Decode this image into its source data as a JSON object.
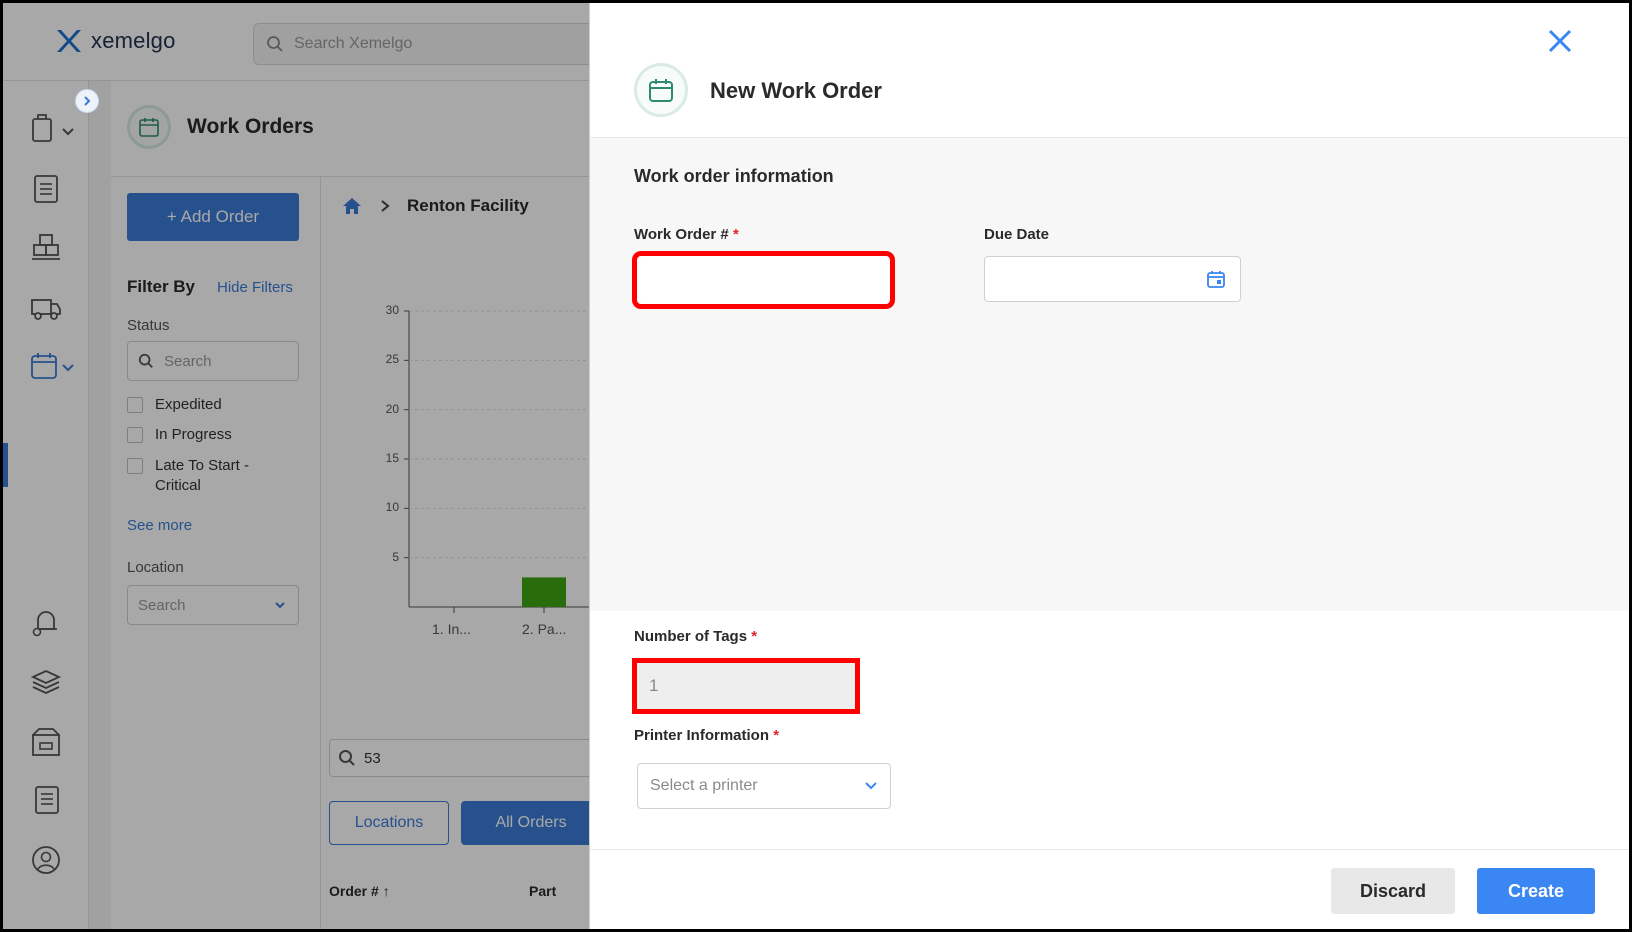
{
  "app": {
    "brand": "xemelgo",
    "search_placeholder": "Search Xemelgo"
  },
  "page": {
    "title": "Work Orders",
    "add_order_label": "+ Add Order",
    "filter_by": "Filter By",
    "hide_filters": "Hide Filters",
    "status_label": "Status",
    "status_search_placeholder": "Search",
    "status_options": [
      "Expedited",
      "In Progress",
      "Late To Start - Critical"
    ],
    "see_more": "See more",
    "location_label": "Location",
    "location_placeholder": "Search",
    "breadcrumb": "Renton Facility",
    "table_search_value": "53",
    "view_buttons": {
      "locations": "Locations",
      "all_orders": "All Orders"
    },
    "columns": [
      "Order # ↑",
      "Part"
    ]
  },
  "chart_data": {
    "type": "bar",
    "categories": [
      "1. In...",
      "2. Pa..."
    ],
    "values": [
      0,
      3
    ],
    "yticks": [
      "30",
      "25",
      "20",
      "15",
      "10",
      "5"
    ],
    "ylim": [
      0,
      30
    ],
    "colors": {
      "bar": "#3ea512",
      "legend_dot": "#3ea512"
    }
  },
  "modal": {
    "title": "New Work Order",
    "section_title": "Work order information",
    "fields": {
      "work_order": {
        "label": "Work Order #",
        "required": "*",
        "value": ""
      },
      "due_date": {
        "label": "Due Date",
        "value": ""
      },
      "num_tags": {
        "label": "Number of Tags",
        "required": "*",
        "value": "1"
      },
      "printer": {
        "label": "Printer Information",
        "required": "*",
        "placeholder": "Select a printer"
      }
    },
    "buttons": {
      "discard": "Discard",
      "create": "Create"
    }
  },
  "colors": {
    "accent": "#3a7bd5",
    "create": "#3a86f2",
    "required": "#e0242b",
    "highlight": "#ff0000"
  }
}
